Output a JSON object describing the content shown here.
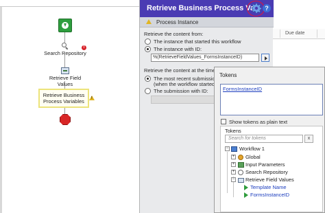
{
  "workflow": {
    "activities": {
      "search_repository": "Search Repository",
      "retrieve_field_values": "Retrieve Field Values",
      "retrieve_business_process_variables": "Retrieve Business Process Variables"
    },
    "badges": {
      "error": "!",
      "warning": "!"
    }
  },
  "grid": {
    "column_due_date": "Due date"
  },
  "properties": {
    "title": "Retrieve Business Process Va...",
    "gear_icon": "gear-icon",
    "help_label": "?",
    "section": "Process Instance",
    "retrieve_content_from": "Retrieve the content from:",
    "option_started_instance": "The instance that started this workflow",
    "option_instance_with_id": "The instance with ID:",
    "instance_id_value": "%(RetrieveFieldValues_FormsInstanceID)",
    "retrieve_time_label": "Retrieve the content at the time of:",
    "option_recent_submission_line1": "The most recent submission",
    "option_recent_submission_line2": "(when the workflow started)",
    "option_submission_with_id": "The submission with ID:",
    "selected_source": "The instance with ID:",
    "selected_time": "The most recent submission"
  },
  "tokens_popup": {
    "title": "Tokens",
    "token_value": "FormsInstanceID",
    "show_plain_text_label": "Show tokens as plain text",
    "show_plain_text_checked": false,
    "tree_header": "Tokens",
    "search_placeholder": "Search for tokens",
    "clear_label": "x",
    "tree": {
      "root": "Workflow 1",
      "children": [
        "Global",
        "Input Parameters",
        "Search Repository",
        "Retrieve Field Values"
      ],
      "leaf_tokens": [
        "Template Name",
        "FormsInstanceID"
      ]
    },
    "expand_glyph": "+",
    "collapse_glyph": "−"
  }
}
